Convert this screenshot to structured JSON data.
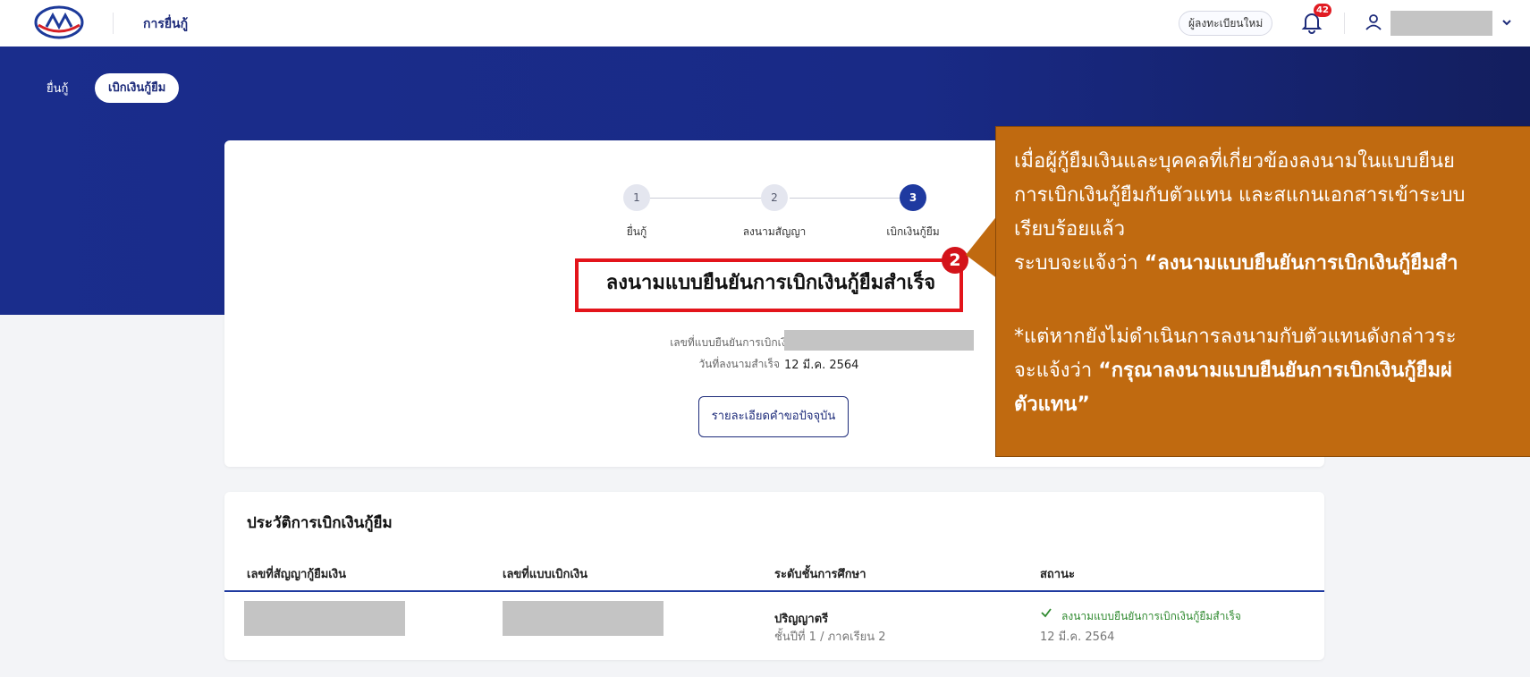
{
  "topbar": {
    "app_title": "การยื่นกู้",
    "new_register_label": "ผู้ลงทะเบียนใหม่",
    "notification_count": "42"
  },
  "subnav": {
    "items": [
      "ยื่นกู้",
      "เบิกเงินกู้ยืม"
    ],
    "active_index": 1
  },
  "stepper": {
    "steps": [
      {
        "number": "1",
        "label": "ยื่นกู้"
      },
      {
        "number": "2",
        "label": "ลงนามสัญญา"
      },
      {
        "number": "3",
        "label": "เบิกเงินกู้ยืม"
      }
    ],
    "current_step": 3
  },
  "result": {
    "title": "ลงนามแบบยืนยันการเบิกเงินกู้ยืมสำเร็จ",
    "form_number_label": "เลขที่แบบยืนยันการเบิกเงินกู้ยืม",
    "signed_date_label": "วันที่ลงนามสำเร็จ",
    "signed_date_value": "12 มี.ค. 2564",
    "detail_button": "รายละเอียดคำขอปัจจุบัน"
  },
  "annotation": {
    "badge_number": "2",
    "lines": [
      "เมื่อผู้กู้ยืมเงินและบุคคลที่เกี่ยวข้องลงนามในแบบยืนย",
      "การเบิกเงินกู้ยืมกับตัวแทน และสแกนเอกสารเข้าระบบ",
      "เรียบร้อยแล้ว",
      "ระบบจะแจ้งว่า ",
      "“ลงนามแบบยืนยันการเบิกเงินกู้ยืมสำ",
      "*แต่หากยังไม่ดำเนินการลงนามกับตัวแทนดังกล่าวระ",
      "จะแจ้งว่า ",
      "“กรุณาลงนามแบบยืนยันการเบิกเงินกู้ยืมผ่",
      "ตัวแทน”"
    ]
  },
  "history": {
    "title": "ประวัติการเบิกเงินกู้ยืม",
    "columns": [
      "เลขที่สัญญากู้ยืมเงิน",
      "เลขที่แบบเบิกเงิน",
      "ระดับชั้นการศึกษา",
      "สถานะ"
    ],
    "rows": [
      {
        "education_level": "ปริญญาตรี",
        "education_detail": "ชั้นปีที่ 1 / ภาคเรียน 2",
        "status": "ลงนามแบบยืนยันการเบิกเงินกู้ยืมสำเร็จ",
        "status_date": "12 มี.ค. 2564"
      }
    ]
  },
  "colors": {
    "primary": "#1f3aa0",
    "callout": "#c06a10",
    "highlight": "#e3141b",
    "success": "#2f8a2f"
  }
}
